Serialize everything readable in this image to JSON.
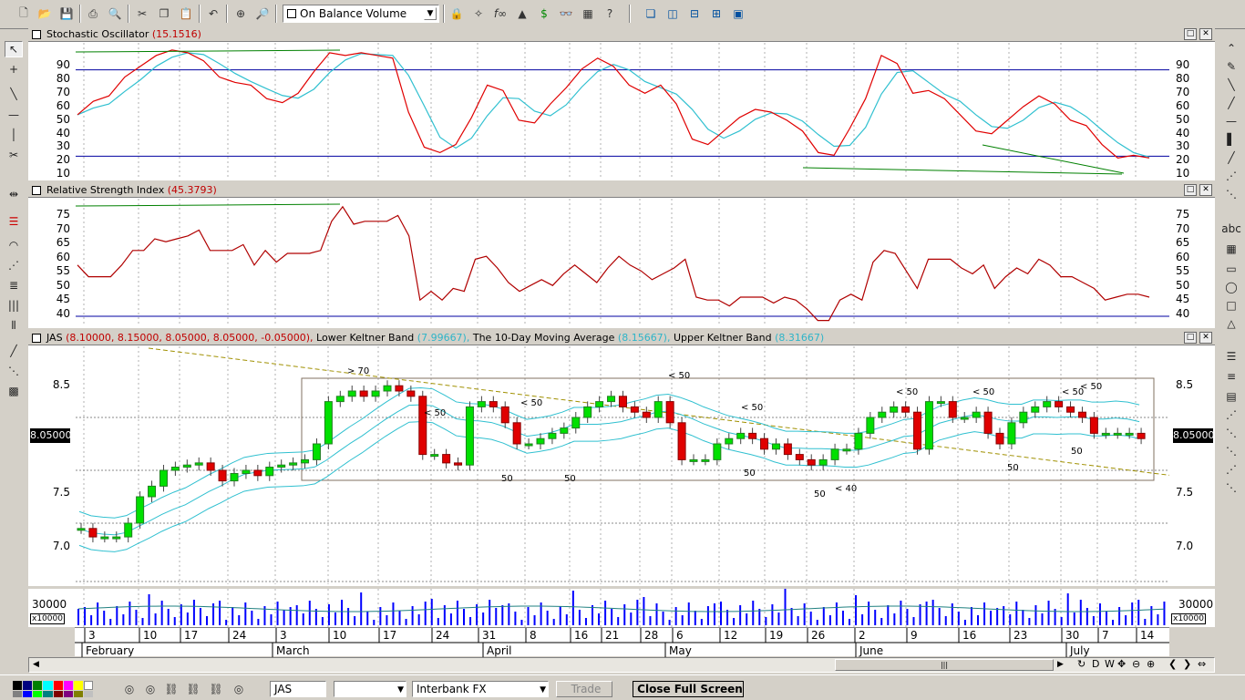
{
  "toolbar": {
    "indicator_select": "On Balance Volume",
    "icons": [
      "new-icon",
      "open-icon",
      "save-icon",
      "print-icon",
      "print-preview-icon",
      "cut-icon",
      "copy-icon",
      "paste-icon",
      "undo-icon",
      "crosshair-icon",
      "zoom-icon",
      "lock-icon",
      "wizard-icon",
      "function-icon",
      "tree-icon",
      "dollar-icon",
      "binoculars-icon",
      "grid-icon",
      "help-icon",
      "cascade-icon",
      "tile-vertical-icon",
      "tile-horizontal-icon",
      "arrange-icon",
      "layout-icon"
    ]
  },
  "stochastic": {
    "title": "Stochastic Oscillator",
    "value": "(15.1516)",
    "axis": [
      "90",
      "80",
      "70",
      "60",
      "50",
      "40",
      "30",
      "20",
      "10"
    ]
  },
  "rsi": {
    "title": "Relative Strength Index",
    "value": "(45.3793)",
    "axis": [
      "75",
      "70",
      "65",
      "60",
      "55",
      "50",
      "45",
      "40"
    ]
  },
  "price": {
    "symbol": "JAS",
    "ohlc": "(8.10000, 8.15000, 8.05000, 8.05000, -0.05000),",
    "lower_label": "Lower Keltner Band",
    "lower_value": "(7.99667),",
    "ma_label": "The 10-Day Moving Average",
    "ma_value": "(8.15667),",
    "upper_label": "Upper Keltner Band",
    "upper_value": "(8.31667)",
    "last": "8.05000",
    "axis": [
      "8.5",
      "8.0",
      "7.5",
      "7.0"
    ],
    "annotations": [
      "> 70",
      "< 50",
      "< 50",
      "< 50",
      "< 50",
      "< 50",
      "< 50",
      "< 50",
      "< 50",
      "50",
      "50",
      "50",
      "50",
      "50",
      "50",
      "< 40",
      "> 40"
    ]
  },
  "volume": {
    "axis": "30000",
    "unit": "x10000"
  },
  "dates": {
    "days": [
      "3",
      "10",
      "17",
      "24",
      "3",
      "10",
      "17",
      "24",
      "31",
      "8",
      "16",
      "21",
      "28",
      "6",
      "12",
      "19",
      "26",
      "2",
      "9",
      "16",
      "23",
      "30",
      "7",
      "14"
    ],
    "months": [
      "February",
      "March",
      "April",
      "May",
      "June",
      "July"
    ]
  },
  "scroll_controls": [
    "D",
    "W"
  ],
  "statusbar": {
    "symbol": "JAS",
    "select_empty": "",
    "feed": "Interbank FX",
    "trade": "Trade",
    "close_full": "Close Full Screen"
  },
  "colors": {
    "stoch_k": "#e00000",
    "stoch_d": "#30c0d0",
    "rsi": "#b00000",
    "band": "#30c0d0",
    "up": "#00e000",
    "down": "#e00000",
    "vol": "#0000ff",
    "hline": "#0000a0"
  }
}
